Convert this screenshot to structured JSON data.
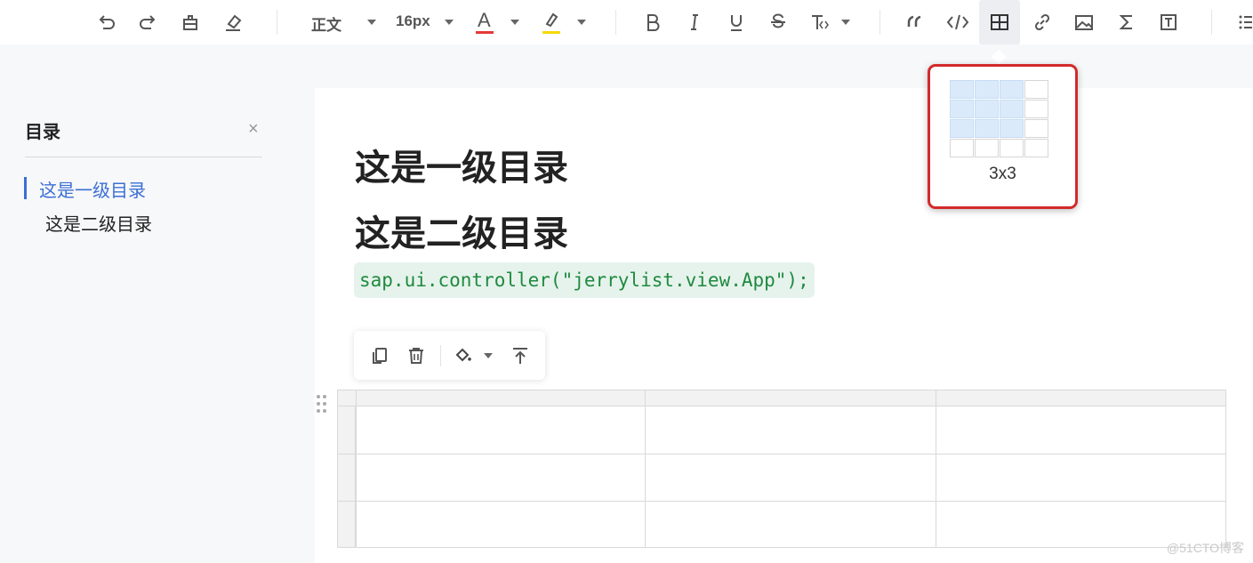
{
  "toolbar": {
    "paragraph_style": "正文",
    "font_size": "16px",
    "font_color_glyph": "A",
    "font_color": "#e53935",
    "highlight_color": "#f5d90a",
    "buttons": [
      "undo-icon",
      "redo-icon",
      "format-painter-icon",
      "clear-format-icon",
      "bold-icon",
      "italic-icon",
      "underline-icon",
      "strikethrough-icon",
      "text-style-icon",
      "quote-icon",
      "code-icon",
      "table-icon",
      "link-icon",
      "image-icon",
      "formula-icon",
      "textbox-icon",
      "list-icon"
    ]
  },
  "toc": {
    "title": "目录",
    "close_glyph": "×",
    "items": [
      {
        "label": "这是一级目录",
        "active": true
      },
      {
        "label": "这是二级目录",
        "active": false
      }
    ]
  },
  "document": {
    "heading1": "这是一级目录",
    "heading2": "这是二级目录",
    "code": "sap.ui.controller(\"jerrylist.view.App\");"
  },
  "table_toolbar": {
    "buttons": [
      "copy-icon",
      "delete-icon",
      "fill-color-icon",
      "insert-above-icon"
    ]
  },
  "table_picker": {
    "label": "3x3",
    "grid_rows": 4,
    "grid_cols": 4,
    "selected_rows": 3,
    "selected_cols": 3
  },
  "table": {
    "rows": 3,
    "cols": 3
  },
  "watermark": "@51CTO博客",
  "colors": {
    "accent": "#3b6fd4",
    "code_text": "#1f8a3f",
    "code_bg": "#e6f3ec",
    "popup_border": "#d32a2a",
    "picker_selected": "#dbeafb"
  }
}
